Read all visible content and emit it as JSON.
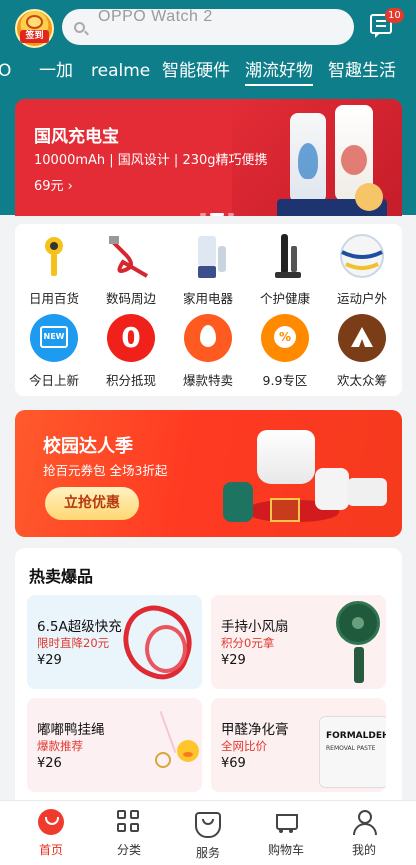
{
  "header": {
    "checkin_label": "签到",
    "search_placeholder": "OPPO Watch 2",
    "message_badge": "10",
    "tabs": [
      {
        "label": "O"
      },
      {
        "label": "一加"
      },
      {
        "label": "realme"
      },
      {
        "label": "智能硬件"
      },
      {
        "label": "潮流好物"
      },
      {
        "label": "智趣生活"
      }
    ],
    "active_tab": "潮流好物"
  },
  "hero": {
    "title": "国风充电宝",
    "subtitle": "10000mAh | 国风设计 | 230g精巧便携",
    "price": "69元 ›"
  },
  "categories": [
    {
      "label": "日用百货",
      "icon": "handheld-fan-icon"
    },
    {
      "label": "数码周边",
      "icon": "cable-icon"
    },
    {
      "label": "家用电器",
      "icon": "blender-icon"
    },
    {
      "label": "个护健康",
      "icon": "toothbrush-icon"
    },
    {
      "label": "运动户外",
      "icon": "volleyball-icon"
    },
    {
      "label": "今日上新",
      "icon": "new-icon"
    },
    {
      "label": "积分抵现",
      "icon": "zero-icon"
    },
    {
      "label": "爆款特卖",
      "icon": "fire-icon"
    },
    {
      "label": "9.9专区",
      "icon": "percent-icon"
    },
    {
      "label": "欢太众筹",
      "icon": "tent-icon"
    }
  ],
  "campus": {
    "title": "校园达人季",
    "subtitle": "抢百元券包 全场3折起",
    "button": "立抢优惠"
  },
  "hot": {
    "title": "热卖爆品",
    "products": [
      {
        "name": "6.5A超级快充",
        "tag": "限时直降20元",
        "price": "¥29"
      },
      {
        "name": "手持小风扇",
        "tag": "积分0元拿",
        "price": "¥29"
      },
      {
        "name": "嘟嘟鸭挂绳",
        "tag": "爆款推荐",
        "price": "¥26"
      },
      {
        "name": "甲醛净化膏",
        "tag": "全网比价",
        "price": "¥69",
        "jar_text": "FORMALDEHYDE",
        "jar_sub": "REMOVAL PASTE"
      }
    ]
  },
  "nav": {
    "items": [
      {
        "label": "首页"
      },
      {
        "label": "分类"
      },
      {
        "label": "服务"
      },
      {
        "label": "购物车"
      },
      {
        "label": "我的"
      }
    ],
    "active": "首页"
  },
  "colors": {
    "header_teal": "#0e7f8a",
    "accent_red": "#e6301f",
    "hero_red": "#e32c36"
  }
}
